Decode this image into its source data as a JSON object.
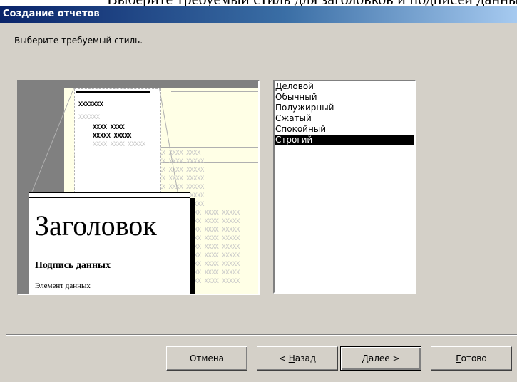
{
  "top_strip_text": "Выберите требуемый стиль для заголовков и подписей данных",
  "window": {
    "title": "Создание отчетов"
  },
  "prompt": "Выберите требуемый стиль.",
  "preview": {
    "col_headers": [
      "XXXXXXX",
      "XXXXXX",
      "XXXX XXXX",
      "XXXXX XXXXX",
      "XXXX XXXX XXXX"
    ],
    "filler": "XXXX XXXX XXXXX",
    "card": {
      "title": "Заголовок",
      "caption": "Подпись данных",
      "item": "Элемент данных"
    }
  },
  "styles": {
    "items": [
      "Деловой",
      "Обычный",
      "Полужирный",
      "Сжатый",
      "Спокойный",
      "Строгий"
    ],
    "selected": "Строгий"
  },
  "buttons": {
    "cancel": {
      "label": "Отмена"
    },
    "back": {
      "prefix": "< ",
      "accel": "Н",
      "rest": "азад"
    },
    "next": {
      "accel": "Д",
      "rest": "алее >"
    },
    "finish": {
      "accel": "Г",
      "rest": "отово"
    }
  },
  "colors": {
    "selection_bg": "#000000",
    "selection_fg": "#ffffff",
    "title_start": "#0a246a",
    "title_end": "#a6caf0",
    "dialog_bg": "#d4d0c8"
  }
}
